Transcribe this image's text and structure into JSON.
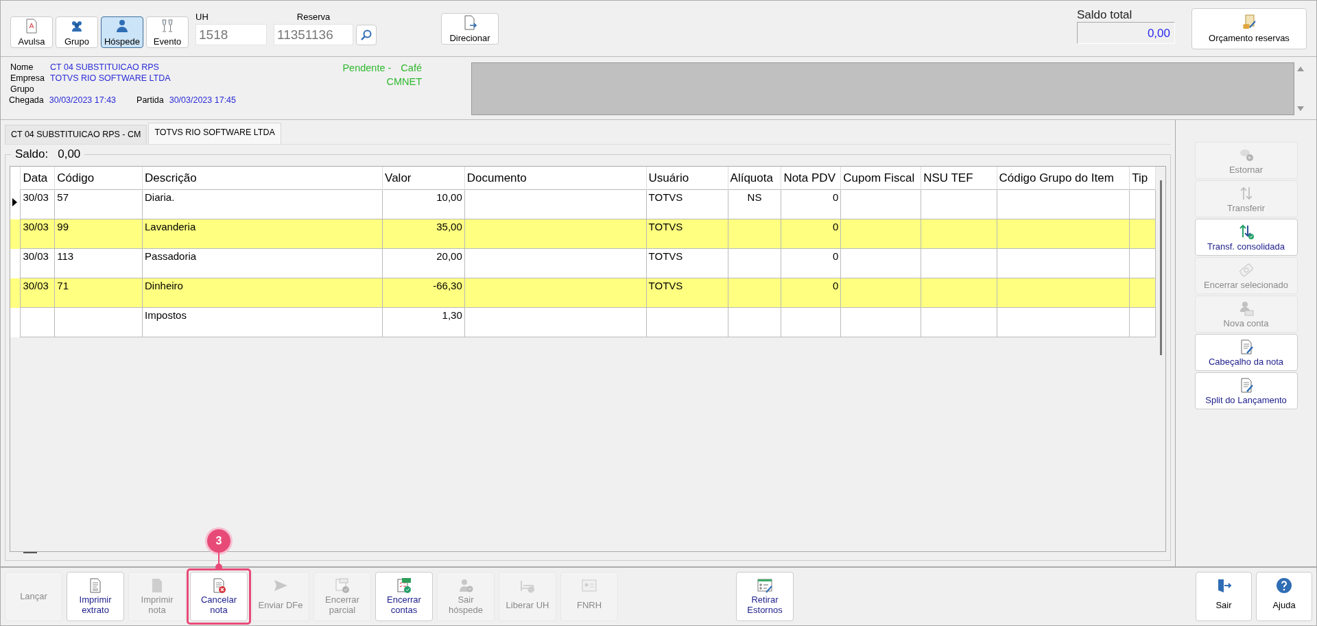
{
  "toolbar": {
    "modes": [
      {
        "label": "Avulsa",
        "selected": false
      },
      {
        "label": "Grupo",
        "selected": false
      },
      {
        "label": "Hóspede",
        "selected": true
      },
      {
        "label": "Evento",
        "selected": false
      }
    ],
    "uh": {
      "label": "UH",
      "value": "1518"
    },
    "reserva": {
      "label": "Reserva",
      "value": "11351136"
    },
    "direcionar": "Direcionar",
    "saldo_total": {
      "label": "Saldo total",
      "value": "0,00"
    },
    "orcamento": "Orçamento reservas"
  },
  "guest": {
    "nome_label": "Nome",
    "nome": "CT 04 SUBSTITUICAO RPS",
    "empresa_label": "Empresa",
    "empresa": "TOTVS RIO SOFTWARE LTDA",
    "grupo_label": "Grupo",
    "chegada_label": "Chegada",
    "chegada": "30/03/2023 17:43",
    "partida_label": "Partida",
    "partida": "30/03/2023 17:45",
    "status": "Pendente -",
    "meal": "Café",
    "code": "CMNET"
  },
  "tabs": [
    {
      "label": "CT 04 SUBSTITUICAO RPS - CM",
      "selected": false
    },
    {
      "label": "TOTVS RIO SOFTWARE LTDA",
      "selected": true
    }
  ],
  "saldo": {
    "label": "Saldo:",
    "value": "0,00"
  },
  "table": {
    "columns": [
      "Data",
      "Código",
      "Descrição",
      "Valor",
      "Documento",
      "Usuário",
      "Alíquota",
      "Nota PDV",
      "Cupom Fiscal",
      "NSU TEF",
      "Código Grupo do Item",
      "Tip"
    ],
    "rows": [
      {
        "current": true,
        "highlighted": false,
        "cells": [
          "30/03",
          "57",
          "Diaria.",
          "10,00",
          "",
          "TOTVS",
          "NS",
          "0",
          "",
          "",
          "",
          ""
        ]
      },
      {
        "current": false,
        "highlighted": true,
        "cells": [
          "30/03",
          "99",
          "Lavanderia",
          "35,00",
          "",
          "TOTVS",
          "",
          "0",
          "",
          "",
          "",
          ""
        ]
      },
      {
        "current": false,
        "highlighted": false,
        "cells": [
          "30/03",
          "113",
          "Passadoria",
          "20,00",
          "",
          "TOTVS",
          "",
          "0",
          "",
          "",
          "",
          ""
        ]
      },
      {
        "current": false,
        "highlighted": true,
        "cells": [
          "30/03",
          "71",
          "Dinheiro",
          "-66,30",
          "",
          "TOTVS",
          "",
          "0",
          "",
          "",
          "",
          ""
        ]
      },
      {
        "current": false,
        "highlighted": false,
        "cells": [
          "",
          "",
          "Impostos",
          "1,30",
          "",
          "",
          "",
          "",
          "",
          "",
          "",
          ""
        ]
      }
    ]
  },
  "side_actions": [
    {
      "label": "Estornar",
      "disabled": true
    },
    {
      "label": "Transferir",
      "disabled": true
    },
    {
      "label": "Transf. consolidada",
      "disabled": false
    },
    {
      "label": "Encerrar selecionado",
      "disabled": true
    },
    {
      "label": "Nova conta",
      "disabled": true
    },
    {
      "label": "Cabeçalho da nota",
      "disabled": false
    },
    {
      "label": "Split do Lançamento",
      "disabled": false
    }
  ],
  "bottom_actions": [
    {
      "label": "Lançar",
      "disabled": true,
      "highlighted": false
    },
    {
      "label": "Imprimir\nextrato",
      "disabled": false,
      "highlighted": false
    },
    {
      "label": "Imprimir\nnota",
      "disabled": true,
      "highlighted": false
    },
    {
      "label": "Cancelar\nnota",
      "disabled": false,
      "highlighted": true
    },
    {
      "label": "Enviar DFe",
      "disabled": true,
      "highlighted": false
    },
    {
      "label": "Encerrar\nparcial",
      "disabled": true,
      "highlighted": false
    },
    {
      "label": "Encerrar\ncontas",
      "disabled": false,
      "highlighted": false
    },
    {
      "label": "Sair\nhóspede",
      "disabled": true,
      "highlighted": false
    },
    {
      "label": "Liberar UH",
      "disabled": true,
      "highlighted": false
    },
    {
      "label": "FNRH",
      "disabled": true,
      "highlighted": false
    }
  ],
  "retirar": {
    "label": "Retirar\nEstornos",
    "disabled": false
  },
  "window_actions": [
    {
      "label": "Sair"
    },
    {
      "label": "Ajuda"
    }
  ],
  "callout": {
    "label": "3"
  }
}
